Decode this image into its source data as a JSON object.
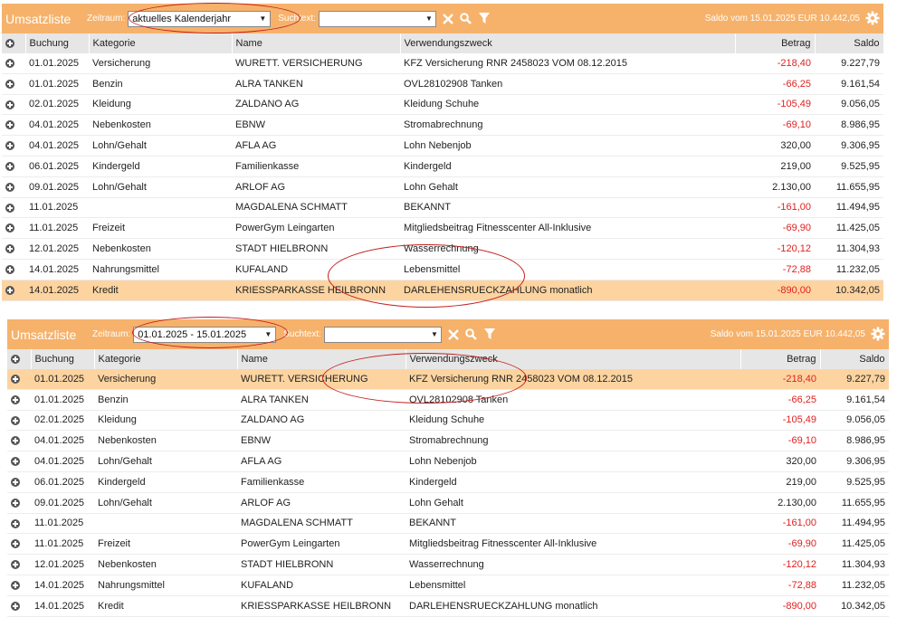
{
  "panels": [
    {
      "title": "Umsatzliste",
      "zeitraum_label": "Zeitraum:",
      "zeitraum_value": "aktuelles Kalenderjahr",
      "suchtext_label": "Suchtext:",
      "saldo_text": "Saldo vom 15.01.2025 EUR 10.442,05",
      "highlight_row": 11
    },
    {
      "title": "Umsatzliste",
      "zeitraum_label": "Zeitraum:",
      "zeitraum_value": "01.01.2025 - 15.01.2025",
      "suchtext_label": "Suchtext:",
      "saldo_text": "Saldo vom 15.01.2025 EUR 10.442,05",
      "highlight_row": 0
    }
  ],
  "columns": [
    "Buchung",
    "Kategorie",
    "Name",
    "Verwendungszweck",
    "Betrag",
    "Saldo"
  ],
  "rows": [
    {
      "buchung": "01.01.2025",
      "kategorie": "Versicherung",
      "name": "WURETT. VERSICHERUNG",
      "zweck": "KFZ Versicherung  RNR 2458023 VOM 08.12.2015",
      "betrag": "-218,40",
      "saldo": "9.227,79",
      "neg": true
    },
    {
      "buchung": "01.01.2025",
      "kategorie": "Benzin",
      "name": "ALRA TANKEN",
      "zweck": "OVL28102908 Tanken",
      "betrag": "-66,25",
      "saldo": "9.161,54",
      "neg": true
    },
    {
      "buchung": "02.01.2025",
      "kategorie": "Kleidung",
      "name": "ZALDANO AG",
      "zweck": "Kleidung Schuhe",
      "betrag": "-105,49",
      "saldo": "9.056,05",
      "neg": true
    },
    {
      "buchung": "04.01.2025",
      "kategorie": "Nebenkosten",
      "name": "EBNW",
      "zweck": "Stromabrechnung",
      "betrag": "-69,10",
      "saldo": "8.986,95",
      "neg": true
    },
    {
      "buchung": "04.01.2025",
      "kategorie": "Lohn/Gehalt",
      "name": "AFLA AG",
      "zweck": "Lohn Nebenjob",
      "betrag": "320,00",
      "saldo": "9.306,95",
      "neg": false
    },
    {
      "buchung": "06.01.2025",
      "kategorie": "Kindergeld",
      "name": "Familienkasse",
      "zweck": "Kindergeld",
      "betrag": "219,00",
      "saldo": "9.525,95",
      "neg": false
    },
    {
      "buchung": "09.01.2025",
      "kategorie": "Lohn/Gehalt",
      "name": "ARLOF AG",
      "zweck": "Lohn Gehalt",
      "betrag": "2.130,00",
      "saldo": "11.655,95",
      "neg": false
    },
    {
      "buchung": "11.01.2025",
      "kategorie": "",
      "name": "MAGDALENA SCHMATT",
      "zweck": "BEKANNT",
      "betrag": "-161,00",
      "saldo": "11.494,95",
      "neg": true
    },
    {
      "buchung": "11.01.2025",
      "kategorie": "Freizeit",
      "name": "PowerGym Leingarten",
      "zweck": "Mitgliedsbeitrag Fitnesscenter All-Inklusive",
      "betrag": "-69,90",
      "saldo": "11.425,05",
      "neg": true
    },
    {
      "buchung": "12.01.2025",
      "kategorie": "Nebenkosten",
      "name": "STADT HIELBRONN",
      "zweck": "Wasserrechnung",
      "betrag": "-120,12",
      "saldo": "11.304,93",
      "neg": true
    },
    {
      "buchung": "14.01.2025",
      "kategorie": "Nahrungsmittel",
      "name": "KUFALAND",
      "zweck": "Lebensmittel",
      "betrag": "-72,88",
      "saldo": "11.232,05",
      "neg": true
    },
    {
      "buchung": "14.01.2025",
      "kategorie": "Kredit",
      "name": "KRIESSPARKASSE HEILBRONN",
      "zweck": "DARLEHENSRUECKZAHLUNG monatlich",
      "betrag": "-890,00",
      "saldo": "10.342,05",
      "neg": true
    }
  ],
  "icons": {
    "add": "plus-circle-icon",
    "clear": "close-icon",
    "search": "search-icon",
    "filter": "filter-icon",
    "settings": "gear-icon"
  },
  "colors": {
    "toolbar": "#f6b26b",
    "highlight": "#fdd4a0",
    "negative": "#e02020",
    "annotation": "#c41e1e"
  }
}
